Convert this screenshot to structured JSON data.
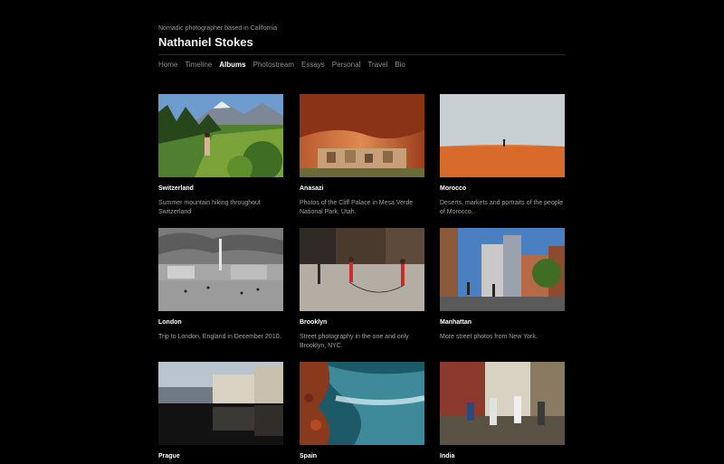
{
  "site": {
    "tagline": "Nomadic photographer based in California",
    "title": "Nathaniel Stokes"
  },
  "nav": {
    "items": [
      "Home",
      "Timeline",
      "Albums",
      "Photostream",
      "Essays",
      "Personal",
      "Travel",
      "Bio"
    ],
    "active": "Albums"
  },
  "albums": [
    {
      "title": "Switzerland",
      "description": "Summer mountain hiking throughout Switzerland"
    },
    {
      "title": "Anasazi",
      "description": "Photos of the Cliff Palace in Mesa Verde National Park, Utah."
    },
    {
      "title": "Morocco",
      "description": "Deserts, markets and portraits of the people of Morocco."
    },
    {
      "title": "London",
      "description": "Trip to London, England in December 2010."
    },
    {
      "title": "Brooklyn",
      "description": "Street photography in the one and only Brooklyn, NYC."
    },
    {
      "title": "Manhattan",
      "description": "More street photos from New York."
    },
    {
      "title": "Prague",
      "description": ""
    },
    {
      "title": "Spain",
      "description": ""
    },
    {
      "title": "India",
      "description": ""
    }
  ],
  "colors": {
    "background": "#000000",
    "text_primary": "#ffffff",
    "text_secondary": "#a3a3a3"
  }
}
